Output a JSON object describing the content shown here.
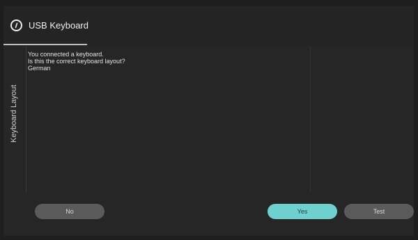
{
  "header": {
    "title": "USB Keyboard"
  },
  "sidebar": {
    "label": "Keyboard Layout"
  },
  "content": {
    "line1": "You connected a keyboard.",
    "line2": "Is this the correct keyboard layout?",
    "layout_value": "German"
  },
  "buttons": {
    "no_label": "No",
    "yes_label": "Yes",
    "test_label": "Test"
  },
  "colors": {
    "accent": "#6fd0d0",
    "button_bg": "#5b5b5b",
    "background": "#262626"
  }
}
